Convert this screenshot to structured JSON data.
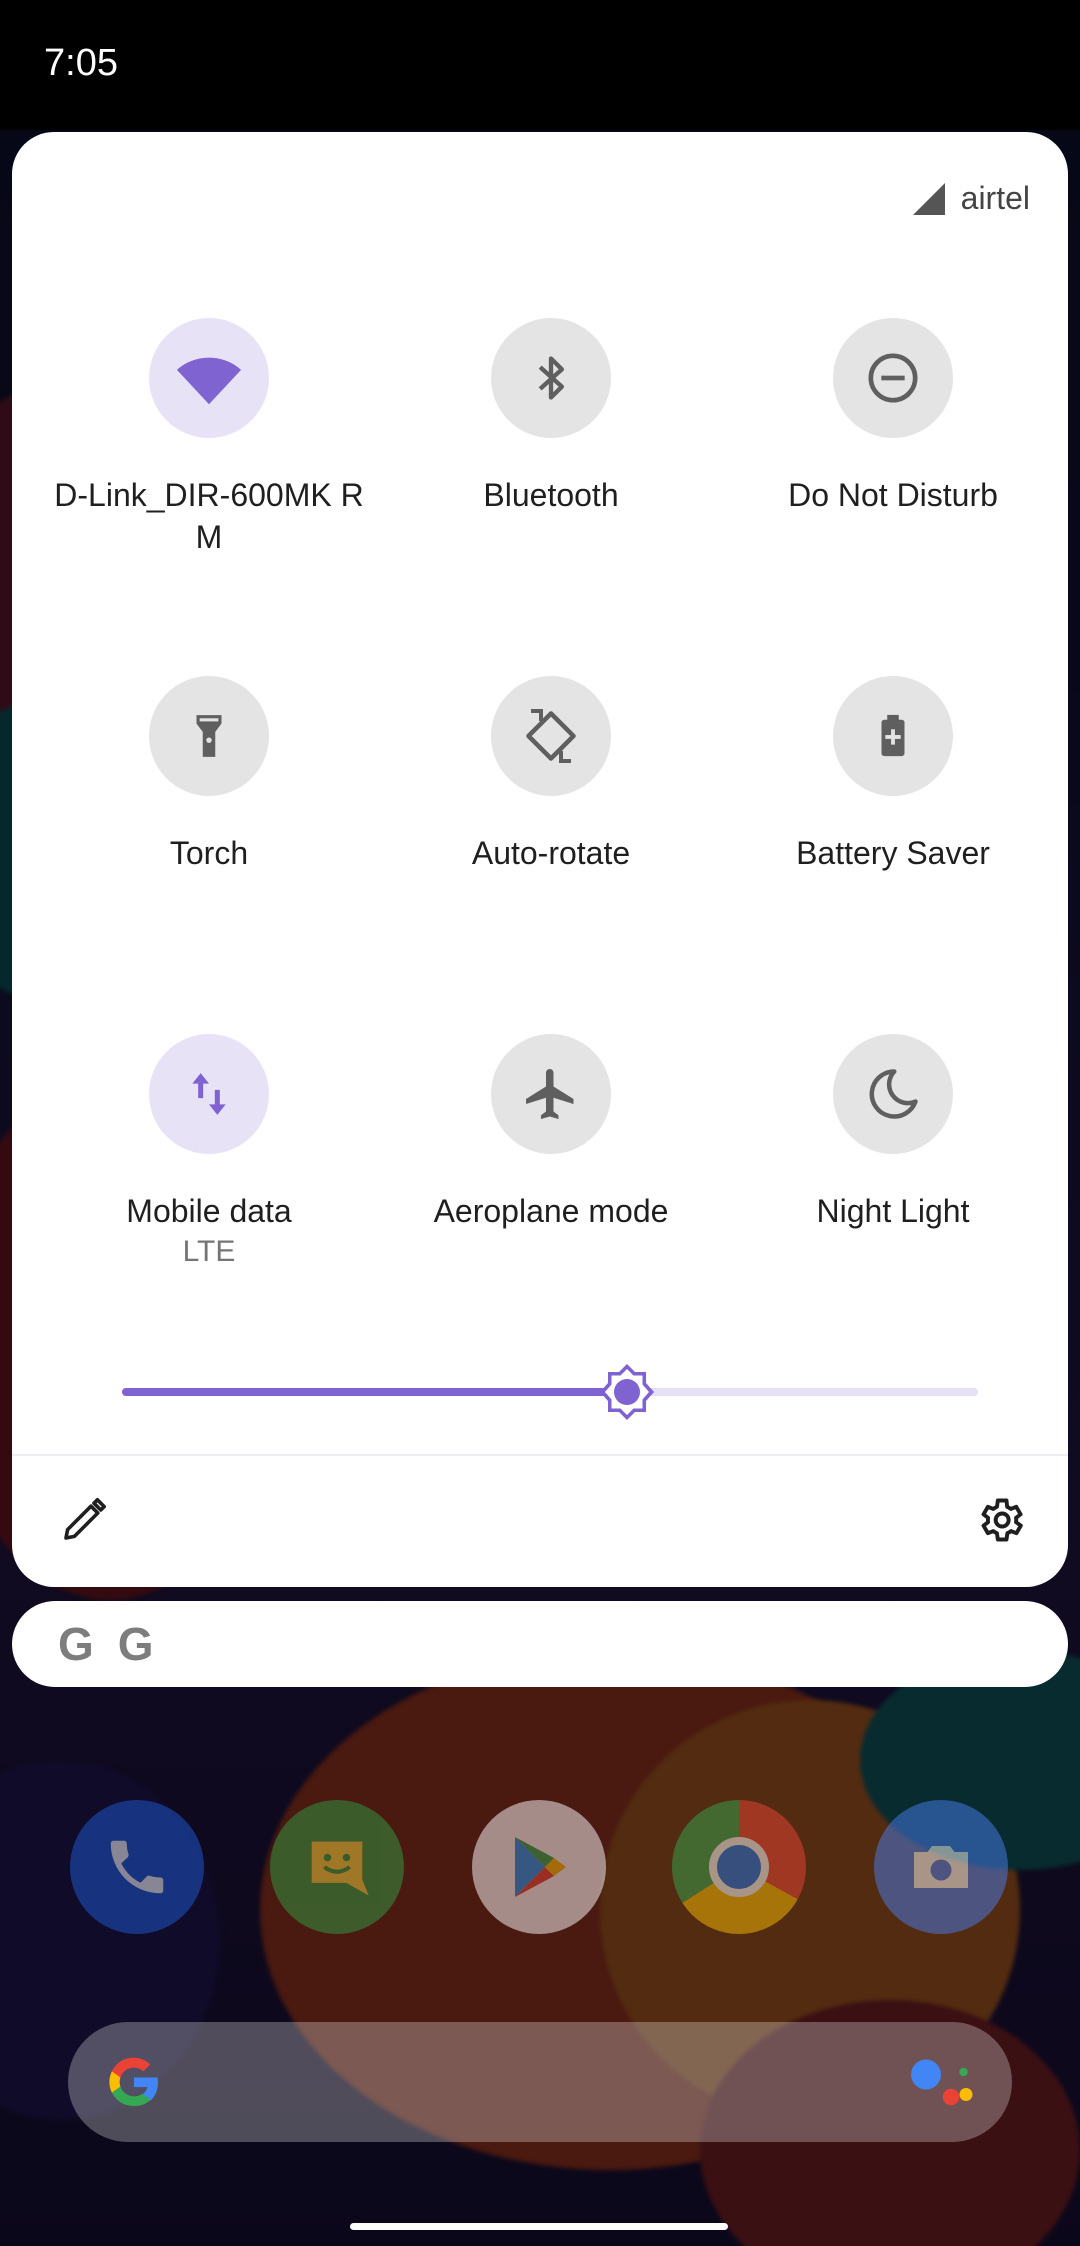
{
  "status_bar": {
    "time": "7:05"
  },
  "quick_settings": {
    "carrier": "airtel",
    "tiles": [
      {
        "label": "D-Link_DIR-600MK RM",
        "sublabel": "",
        "icon": "wifi-icon",
        "active": true
      },
      {
        "label": "Bluetooth",
        "sublabel": "",
        "icon": "bluetooth-icon",
        "active": false
      },
      {
        "label": "Do Not Disturb",
        "sublabel": "",
        "icon": "do-not-disturb-icon",
        "active": false
      },
      {
        "label": "Torch",
        "sublabel": "",
        "icon": "torch-icon",
        "active": false
      },
      {
        "label": "Auto-rotate",
        "sublabel": "",
        "icon": "auto-rotate-icon",
        "active": false
      },
      {
        "label": "Battery Saver",
        "sublabel": "",
        "icon": "battery-saver-icon",
        "active": false
      },
      {
        "label": "Mobile data",
        "sublabel": "LTE",
        "icon": "mobile-data-icon",
        "active": true
      },
      {
        "label": "Aeroplane mode",
        "sublabel": "",
        "icon": "airplane-icon",
        "active": false
      },
      {
        "label": "Night Light",
        "sublabel": "",
        "icon": "night-light-icon",
        "active": false
      }
    ],
    "brightness_level": 0.59,
    "footer": {
      "edit_icon": "pencil-icon",
      "settings_icon": "gear-icon"
    }
  },
  "google_bar": {
    "letters": [
      "G",
      "G"
    ]
  },
  "dock": {
    "apps": [
      "phone-icon",
      "messages-icon",
      "play-store-icon",
      "chrome-icon",
      "camera-icon"
    ]
  },
  "colors": {
    "accent": "#7e63d1",
    "active_tile": "#e8e2f7",
    "inactive_tile": "#e4e4e4"
  }
}
